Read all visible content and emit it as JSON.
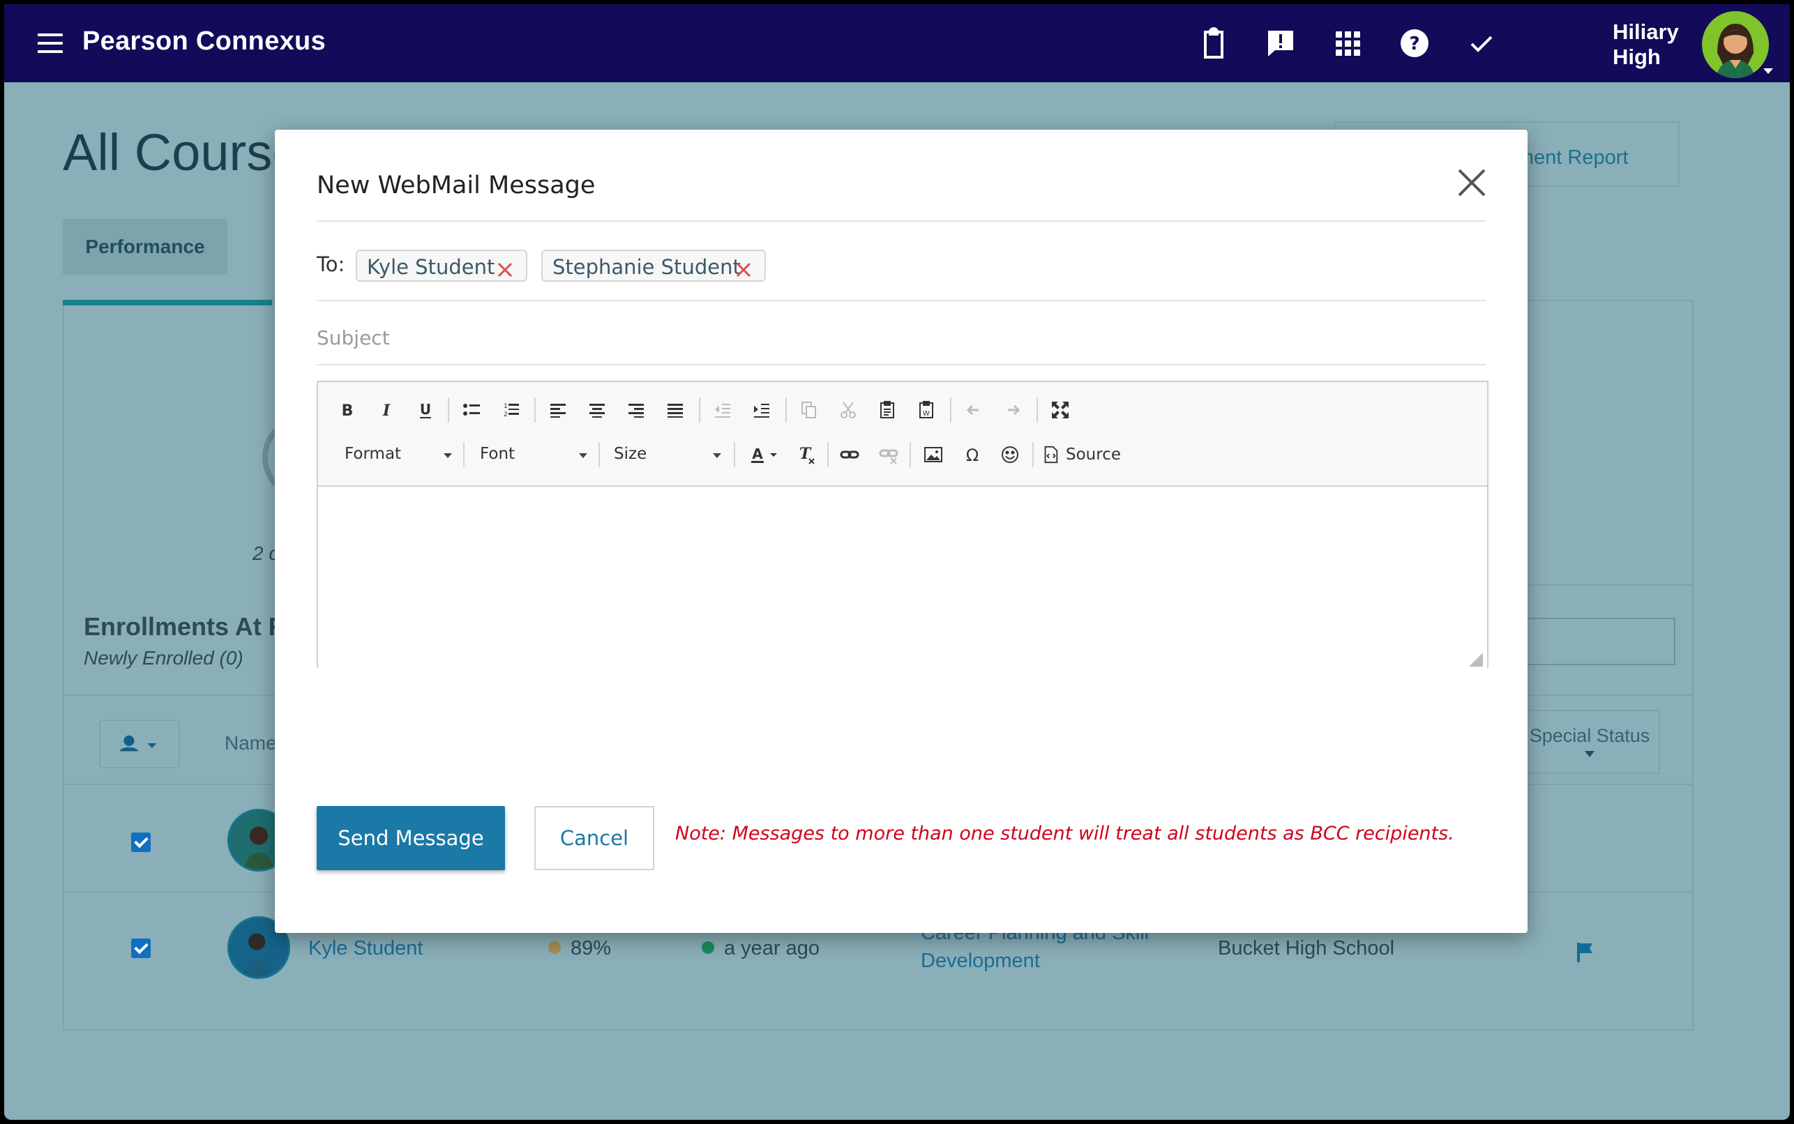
{
  "app": {
    "title": "Pearson Connexus"
  },
  "user": {
    "name": "Hiliary High"
  },
  "top_icons": [
    "clipboard-icon",
    "alert-icon",
    "apps-grid-icon",
    "help-icon",
    "checkmark-icon"
  ],
  "background": {
    "heading": "All Courses",
    "report_button": "llment Report",
    "performance_tab": "Performance",
    "count_text": "2 c",
    "enrollments_heading": "Enrollments At R",
    "enrollments_sub": "Newly Enrolled (0)",
    "columns": {
      "name": "Name",
      "special_status": "Special Status"
    },
    "rows": [
      {
        "name": "Kyle Student",
        "grade": "89%",
        "last_activity": "a year ago",
        "course_line1": "Career Planning and Skill",
        "course_line2": "Development",
        "school": "Bucket High School"
      }
    ]
  },
  "modal": {
    "title": "New WebMail Message",
    "to_label": "To:",
    "recipients": [
      "Kyle Student",
      "Stephanie Student"
    ],
    "subject_placeholder": "Subject",
    "subject_value": "",
    "toolbar": {
      "format_label": "Format",
      "font_label": "Font",
      "size_label": "Size",
      "source_label": "Source"
    },
    "body": "",
    "send_label": "Send Message",
    "cancel_label": "Cancel",
    "note": "Note: Messages to more than one student will treat all students as BCC recipients."
  },
  "colors": {
    "topbar": "#110b5a",
    "overlay_bg": "#8aafb8",
    "primary": "#1a79a6",
    "note_red": "#d0021b",
    "chip_remove": "#d9534f"
  }
}
